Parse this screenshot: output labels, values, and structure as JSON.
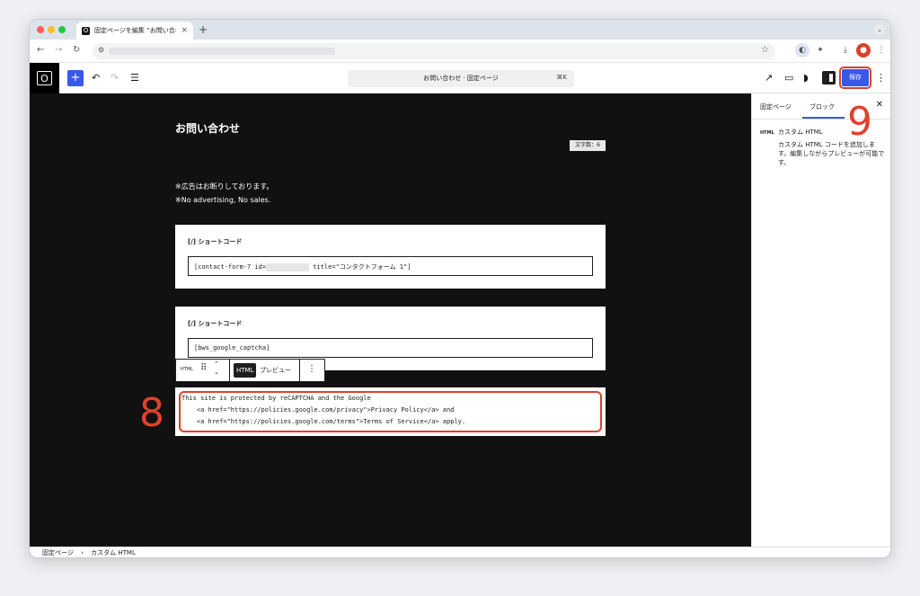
{
  "browser": {
    "tab_title": "固定ページを編集 “お問い合わせ",
    "tab_favicon": "O",
    "tab_close": "×",
    "new_tab": "+",
    "tab_menu_icon": "⌄",
    "traffic_colors": [
      "#ff5f57",
      "#febc2e",
      "#28c840"
    ]
  },
  "wp_header": {
    "site_logo": "O",
    "add_icon": "+",
    "doc_title": "お問い合わせ · 固定ページ",
    "doc_shortcut": "⌘K",
    "save_label": "保存"
  },
  "canvas": {
    "page_title": "お問い合わせ",
    "char_count": "文字数：6",
    "note_jp": "※広告はお断りしております。",
    "note_en": "※No advertising, No sales.",
    "shortcode_label": "[/] ショートコード",
    "shortcode1_before": "[contact-form-7 id=",
    "shortcode1_after": " title=\"コンタクトフォーム 1\"]",
    "shortcode2_label": "[/] ショートコード",
    "shortcode2_value": "[bws_google_captcha]",
    "block_toolbar": {
      "type_label": "HTML",
      "tab_html": "HTML",
      "tab_preview": "プレビュー"
    },
    "html_code": [
      "This site is protected by reCAPTCHA and the Google",
      "    <a href=\"https://policies.google.com/privacy\">Privacy Policy</a> and",
      "    <a href=\"https://policies.google.com/terms\">Terms of Service</a> apply."
    ]
  },
  "sidebar": {
    "tab_page": "固定ページ",
    "tab_block": "ブロック",
    "block_icon_label": "HTML",
    "block_title": "カスタム HTML",
    "block_description": "カスタム HTML コードを追加します。編集しながらプレビューが可能です。"
  },
  "annotations": {
    "step_8": "8",
    "step_9": "9",
    "highlight_color": "#d9412c"
  },
  "footer": {
    "crumb_1": "固定ページ",
    "separator": "›",
    "crumb_2": "カスタム HTML"
  }
}
